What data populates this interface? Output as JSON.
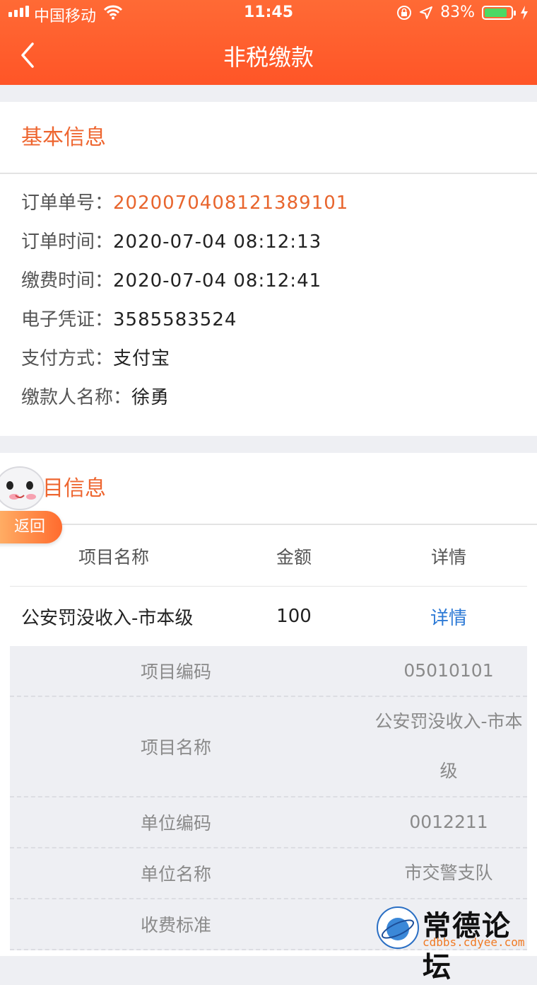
{
  "status_bar": {
    "carrier": "中国移动",
    "time": "11:45",
    "battery": "83%",
    "battery_level": 0.83
  },
  "nav": {
    "title": "非税缴款"
  },
  "basic_info": {
    "title": "基本信息",
    "rows": [
      {
        "label": "订单单号：",
        "value": "20200704081213891​01"
      },
      {
        "label": "订单时间：",
        "value": "2020-07-04 08:12:13"
      },
      {
        "label": "缴费时间：",
        "value": "2020-07-04 08:12:41"
      },
      {
        "label": "电子凭证：",
        "value": "3585583524"
      },
      {
        "label": "支付方式：",
        "value": "支付宝"
      },
      {
        "label": "缴款人名称：",
        "value": "徐勇"
      }
    ]
  },
  "project_info": {
    "title": "项目信息",
    "headers": [
      "项目名称",
      "金额",
      "详情"
    ],
    "row": {
      "name": "公安罚没收入-市本级",
      "amount": "100",
      "detail": "详情"
    },
    "details": [
      {
        "label": "项目编码",
        "value": "05010101"
      },
      {
        "label": "项目名称",
        "value": "公安罚没收入-市本级"
      },
      {
        "label": "单位编码",
        "value": "0012211"
      },
      {
        "label": "单位名称",
        "value": "市交警支队"
      },
      {
        "label": "收费标准",
        "value": ""
      }
    ]
  },
  "floating": {
    "back_label": "返回"
  },
  "watermark": {
    "brand": "常德论坛",
    "url": "cdbbs.cdyee.com"
  },
  "colors": {
    "accent": "#ff5a2b",
    "link": "#2d7ad6",
    "order_no": "#e8652d"
  }
}
